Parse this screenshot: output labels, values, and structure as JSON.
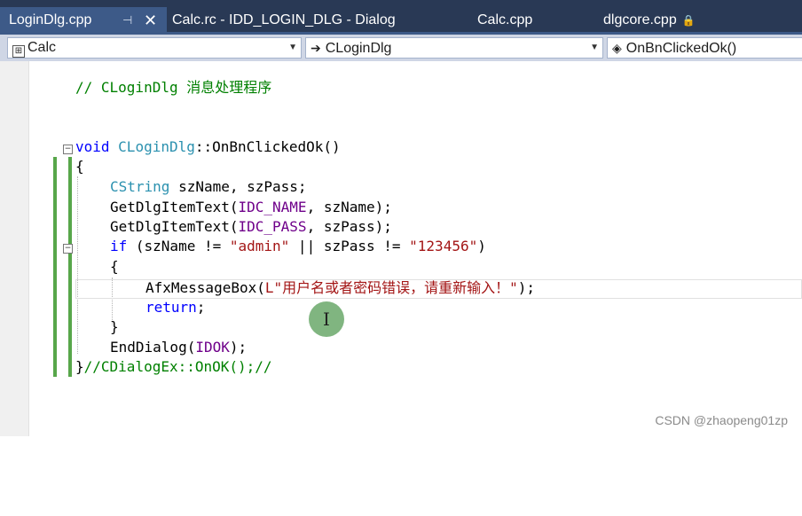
{
  "tabs": [
    {
      "label": "LoginDlg.cpp",
      "active": true,
      "pin_glyph": "⊣",
      "close_glyph": "✕"
    },
    {
      "label": "Calc.rc - IDD_LOGIN_DLG - Dialog"
    },
    {
      "label": "Calc.cpp"
    },
    {
      "label": "dlgcore.cpp",
      "lock_glyph": "🔒"
    }
  ],
  "navbar": {
    "project": "Calc",
    "class": "CLoginDlg",
    "method": "OnBnClickedOk()",
    "dropdown_glyph": "▼",
    "class_icon": "➔",
    "method_icon": "◈"
  },
  "code": {
    "comment_handler": "// CLoginDlg 消息处理程序",
    "func_sig_kw": "void",
    "func_sig_class": "CLoginDlg",
    "func_sig_rest": "::OnBnClickedOk()",
    "open_brace": "{",
    "line_cstring_type": "CString",
    "line_cstring_rest": " szName, szPass;",
    "line_get1_fn": "GetDlgItemText(",
    "line_get1_macro": "IDC_NAME",
    "line_get1_rest": ", szName);",
    "line_get2_fn": "GetDlgItemText(",
    "line_get2_macro": "IDC_PASS",
    "line_get2_rest": ", szPass);",
    "line_if_kw": "if",
    "line_if_a": " (szName != ",
    "line_if_str1": "\"admin\"",
    "line_if_b": " || szPass != ",
    "line_if_str2": "\"123456\"",
    "line_if_c": ")",
    "inner_open": "{",
    "line_msg_a": "AfxMessageBox(",
    "line_msg_str": "L\"用户名或者密码错误，请重新输入！\"",
    "line_msg_b": ");",
    "line_return_kw": "return",
    "line_return_rest": ";",
    "inner_close": "}",
    "line_end_a": "EndDialog(",
    "line_end_macro": "IDOK",
    "line_end_b": ");",
    "close_line_brace": "}",
    "close_line_comment": "//CDialogEx::OnOK();//"
  },
  "ibeam_glyph": "I",
  "collapse_glyph": "−",
  "watermark": "CSDN @zhaopeng01zp",
  "colors": {
    "tab_bar": "#293955",
    "active_tab": "#3d5a88",
    "comment": "#008000",
    "keyword": "#0000ff",
    "type": "#2b91af",
    "string": "#a31515",
    "macro": "#6f008a",
    "change_bar": "#57a64a"
  }
}
